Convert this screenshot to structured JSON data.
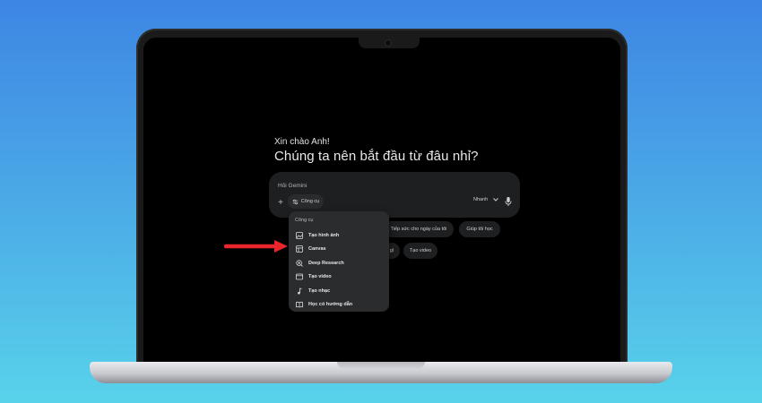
{
  "greeting": {
    "hello": "Xin chào Anh!",
    "question": "Chúng ta nên bắt đầu từ đâu nhỉ?"
  },
  "prompt": {
    "placeholder": "Hỏi Gemini",
    "tools_label": "Công cụ",
    "model_label": "Nhanh"
  },
  "menu": {
    "title": "Công cụ",
    "items": [
      {
        "label": "Tạo hình ảnh",
        "icon": "image-icon"
      },
      {
        "label": "Canvas",
        "icon": "canvas-icon"
      },
      {
        "label": "Deep Research",
        "icon": "deep-research-icon"
      },
      {
        "label": "Tạo video",
        "icon": "video-icon"
      },
      {
        "label": "Tạo nhạc",
        "icon": "music-note-icon"
      },
      {
        "label": "Học có hướng dẫn",
        "icon": "book-icon"
      }
    ]
  },
  "chips": [
    {
      "label": "Tiếp sức cho ngày của tôi"
    },
    {
      "label": "Giúp tôi học"
    },
    {
      "label": "gì"
    },
    {
      "label": "Tạo video"
    }
  ],
  "colors": {
    "annotation_arrow": "#e8262b",
    "background_top": "#3d86e4",
    "background_bottom": "#58d2ea"
  }
}
